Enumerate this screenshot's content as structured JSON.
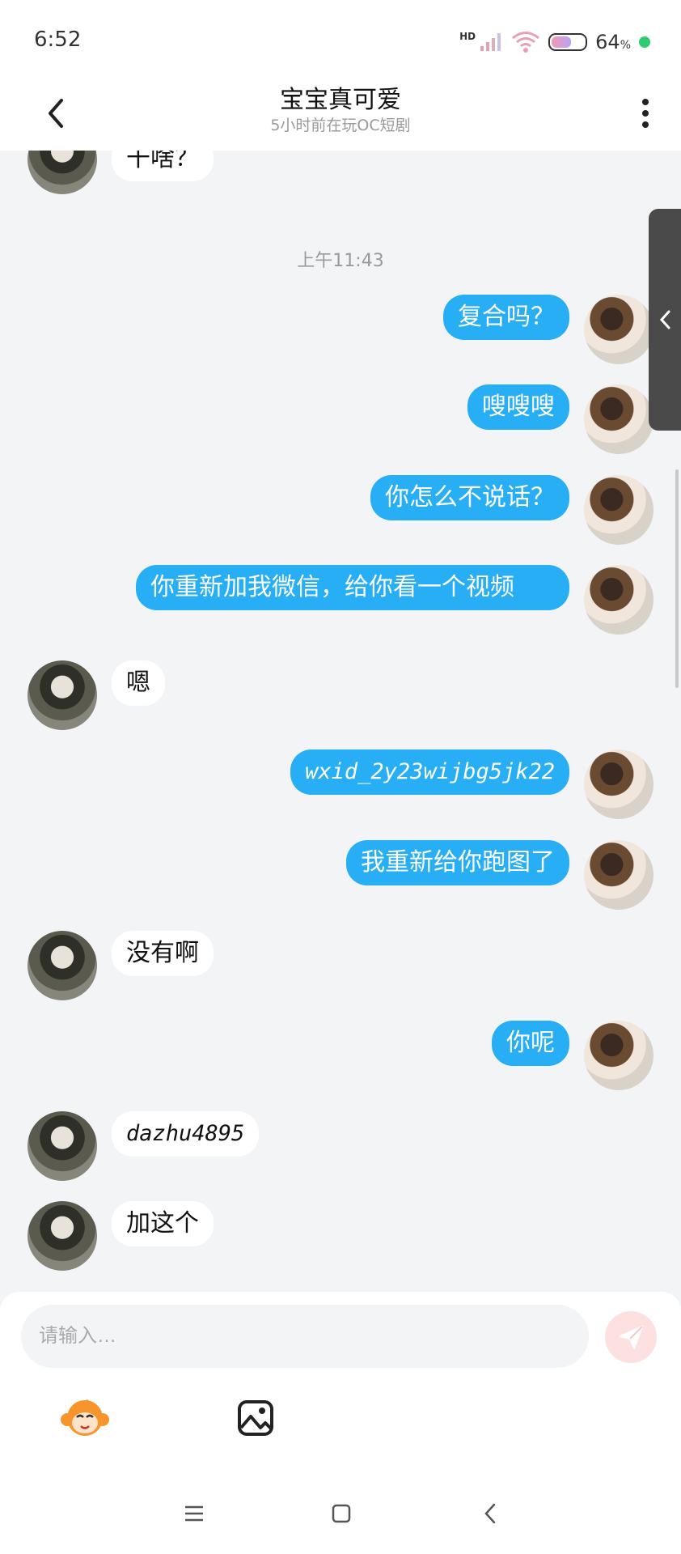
{
  "status_bar": {
    "time": "6:52",
    "network_label": "HD",
    "battery_percent": "64",
    "battery_unit": "%",
    "battery_level": 0.64
  },
  "header": {
    "title": "宝宝真可爱",
    "subtitle": "5小时前在玩OC短剧"
  },
  "chat": {
    "partial_top_message": "干啥？",
    "timestamp": "上午11:43",
    "messages": [
      {
        "side": "out",
        "text": "复合吗？"
      },
      {
        "side": "out",
        "text": "嗖嗖嗖"
      },
      {
        "side": "out",
        "text": "你怎么不说话？"
      },
      {
        "side": "out",
        "text": "你重新加我微信，给你看一个视频"
      },
      {
        "side": "in",
        "text": "嗯"
      },
      {
        "side": "out",
        "text": "wxid_2y23wijbg5jk22"
      },
      {
        "side": "out",
        "text": "我重新给你跑图了"
      },
      {
        "side": "in",
        "text": "没有啊"
      },
      {
        "side": "out",
        "text": "你呢"
      },
      {
        "side": "in",
        "text": "dazhu4895"
      },
      {
        "side": "in",
        "text": "加这个"
      }
    ]
  },
  "composer": {
    "placeholder": "请输入…"
  },
  "icons": {
    "back": "chevron-left-icon",
    "more": "more-vertical-icon",
    "send": "send-icon",
    "emoji": "monkey-emoji-icon",
    "image": "image-icon",
    "nav_menu": "menu-icon",
    "nav_home": "home-square-icon",
    "nav_back": "back-arrow-icon"
  },
  "colors": {
    "outgoing_bubble": "#27aef5",
    "incoming_bubble": "#ffffff",
    "background": "#f3f4f6",
    "send_button": "#fde1e1"
  }
}
